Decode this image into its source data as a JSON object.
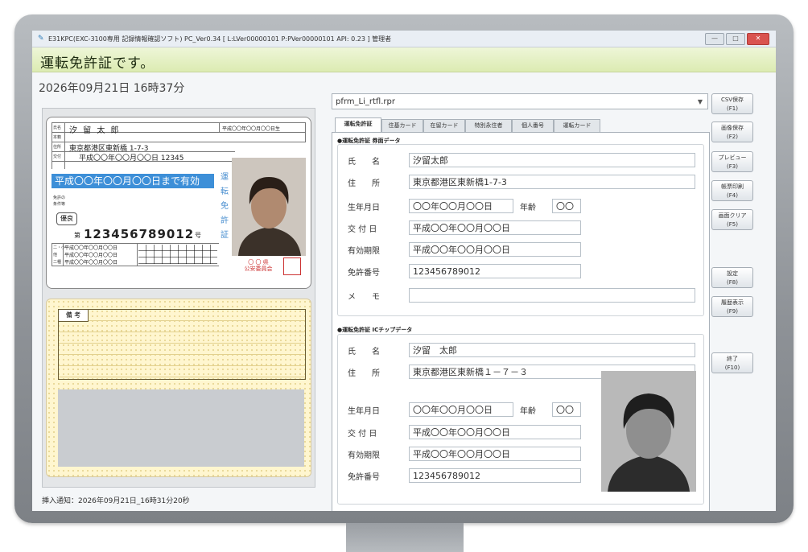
{
  "window": {
    "title": "E31KPC(EXC-3100専用 記録情報確認ソフト) PC_Ver0.34 [ L:LVer00000101 P:PVer00000101 API: 0.23 ] 管理者"
  },
  "heading": "運転免許証です。",
  "datetime": "2026年09月21日 16時37分",
  "status_bar": "挿入通知：2026年09月21日_16時31分20秒",
  "card": {
    "name_label": "氏名",
    "name": "汐 留 太 郎",
    "birth": "平成〇〇年〇〇月〇〇日生",
    "honseki_label": "本籍",
    "address_label": "住所",
    "address": "東京都港区東新橋 1-7-3",
    "issue_label": "交付",
    "issue": "平成〇〇年〇〇月〇〇日 12345",
    "validity": "平成〇〇年〇〇月〇〇日まで有効",
    "vertical_label": "運転免許証",
    "condition_label1": "免許の",
    "condition_label2": "条件等",
    "badge": "優良",
    "number_prefix": "第",
    "number": "123456789012",
    "number_suffix": "号",
    "dates": [
      "平成〇〇年〇〇月〇〇日",
      "平成〇〇年〇〇月〇〇日",
      "平成〇〇年〇〇月〇〇日"
    ],
    "row_labels": [
      "二・小",
      "他",
      "二種"
    ],
    "authority": "〇 〇 県\n公安委員会"
  },
  "remarks": {
    "label": "備 考"
  },
  "dropdown": {
    "value": "pfrm_Li_rtfl.rpr"
  },
  "tabs": [
    "運転免許証",
    "住基カード",
    "在留カード",
    "特別永住者",
    "個人番号",
    "運転カード"
  ],
  "surface": {
    "section_title": "●運転免許証 券面データ",
    "name_label": "氏　　名",
    "name": "汐留太郎",
    "address_label": "住　　所",
    "address": "東京都港区東新橋1-7-3",
    "birth_label": "生年月日",
    "birth": "〇〇年〇〇月〇〇日",
    "age_label": "年齢",
    "age": "〇〇",
    "issue_label": "交 付 日",
    "issue": "平成〇〇年〇〇月〇〇日",
    "expiry_label": "有効期限",
    "expiry": "平成〇〇年〇〇月〇〇日",
    "license_label": "免許番号",
    "license": "123456789012",
    "memo_label": "メ　　モ",
    "memo": ""
  },
  "chip": {
    "section_title": "●運転免許証 ICチップデータ",
    "name_label": "氏　　名",
    "name": "汐留　太郎",
    "address_label": "住　　所",
    "address": "東京都港区東新橋１－７－３",
    "birth_label": "生年月日",
    "birth": "〇〇年〇〇月〇〇日",
    "age_label": "年齢",
    "age": "〇〇",
    "issue_label": "交 付 日",
    "issue": "平成〇〇年〇〇月〇〇日",
    "expiry_label": "有効期限",
    "expiry": "平成〇〇年〇〇月〇〇日",
    "license_label": "免許番号",
    "license": "123456789012"
  },
  "side_buttons": {
    "csv": "CSV保存\n(F1)",
    "image": "画像保存\n(F2)",
    "preview": "プレビュー\n(F3)",
    "print": "帳票印刷\n(F4)",
    "clear": "画面クリア\n(F5)",
    "settings": "設定\n(F8)",
    "history": "履歴表示\n(F9)",
    "exit": "終了\n(F10)"
  },
  "window_buttons": {
    "minimize": "—",
    "maximize": "□",
    "close": "✕"
  },
  "colors": {
    "validity_band": "#3d8fd8",
    "heading_bg": "#dcebb2",
    "remarks_bg": "#fff6cf",
    "close_btn": "#d9534f"
  }
}
